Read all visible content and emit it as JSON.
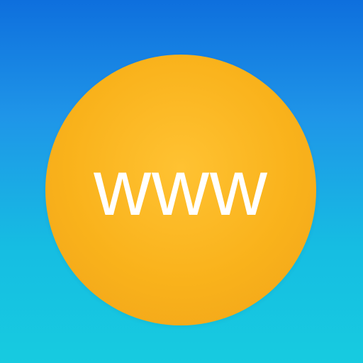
{
  "icon": {
    "label": "www",
    "colors": {
      "background_top": "#0e6fdd",
      "background_bottom": "#17cbe0",
      "circle": "#f9b21b",
      "text": "#ffffff"
    }
  }
}
